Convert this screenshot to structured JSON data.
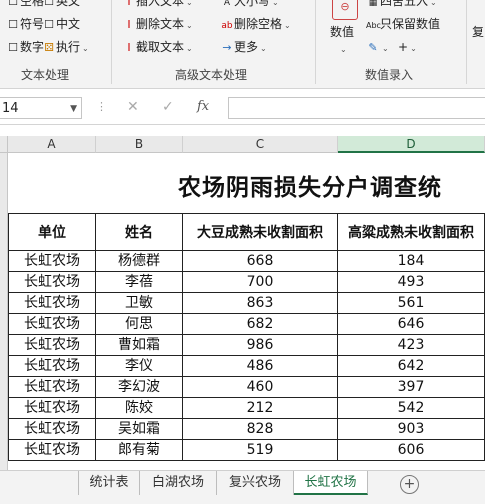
{
  "ribbon": {
    "col1": [
      "空格",
      "符号",
      "数字"
    ],
    "col2": [
      "英文",
      "中文",
      "执行"
    ],
    "col3": [
      "插入文本",
      "删除文本",
      "截取文本"
    ],
    "col4": [
      "大小写",
      "删除空格",
      "更多"
    ],
    "col5_label": "数值",
    "col6": [
      "四舍五入",
      "只保留数值"
    ],
    "col7": "复",
    "groups": [
      "文本处理",
      "高级文本处理",
      "数值录入"
    ]
  },
  "formula_bar": {
    "name_box": "14",
    "fx": "fx",
    "value": ""
  },
  "columns": [
    "A",
    "B",
    "C",
    "D"
  ],
  "sheet": {
    "title": "农场阴雨损失分户调查统",
    "headers": [
      "单位",
      "姓名",
      "大豆成熟未收割面积",
      "高粱成熟未收割面积"
    ],
    "rows": [
      [
        "长虹农场",
        "杨德群",
        "668",
        "184"
      ],
      [
        "长虹农场",
        "李蓓",
        "700",
        "493"
      ],
      [
        "长虹农场",
        "卫敏",
        "863",
        "561"
      ],
      [
        "长虹农场",
        "何思",
        "682",
        "646"
      ],
      [
        "长虹农场",
        "曹如霜",
        "986",
        "423"
      ],
      [
        "长虹农场",
        "李仪",
        "486",
        "642"
      ],
      [
        "长虹农场",
        "李幻波",
        "460",
        "397"
      ],
      [
        "长虹农场",
        "陈姣",
        "212",
        "542"
      ],
      [
        "长虹农场",
        "吴如霜",
        "828",
        "903"
      ],
      [
        "长虹农场",
        "郎有菊",
        "519",
        "606"
      ]
    ]
  },
  "tabs": [
    "统计表",
    "白湖农场",
    "复兴农场",
    "长虹农场"
  ],
  "active_tab": "长虹农场"
}
